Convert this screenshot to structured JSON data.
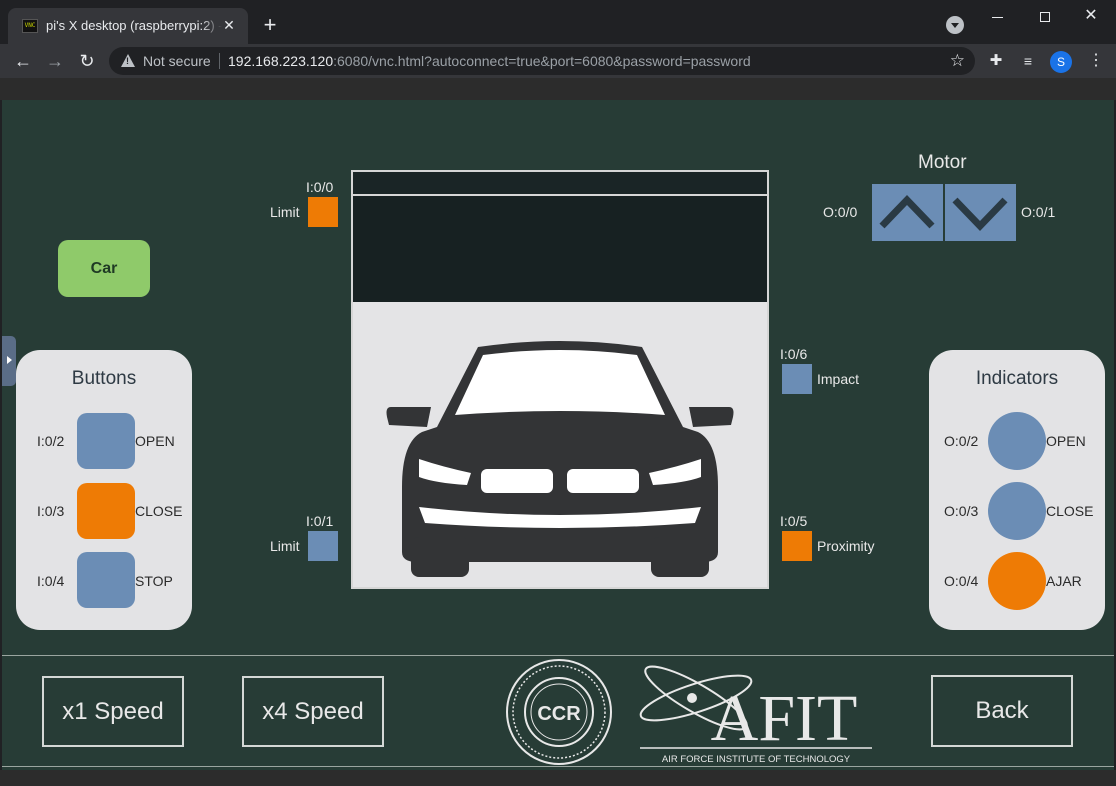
{
  "browser": {
    "tab_title": "pi's X desktop (raspberrypi:2) - noVNC",
    "favicon_text": "VNC",
    "tab_close": "✕",
    "new_tab": "+",
    "not_secure": "Not secure",
    "url_host": "192.168.223.120",
    "url_rest": ":6080/vnc.html?autoconnect=true&port=6080&password=password",
    "profile_initial": "S"
  },
  "hmi": {
    "car_button": "Car",
    "buttons_panel": {
      "title": "Buttons",
      "items": [
        {
          "address": "I:0/2",
          "label": "OPEN",
          "color": "#6b8db5"
        },
        {
          "address": "I:0/3",
          "label": "CLOSE",
          "color": "#ee7b05"
        },
        {
          "address": "I:0/4",
          "label": "STOP",
          "color": "#6b8db5"
        }
      ]
    },
    "indicators_panel": {
      "title": "Indicators",
      "items": [
        {
          "address": "O:0/2",
          "label": "OPEN",
          "color": "#6b8db5"
        },
        {
          "address": "O:0/3",
          "label": "CLOSE",
          "color": "#6b8db5"
        },
        {
          "address": "O:0/4",
          "label": "AJAR",
          "color": "#ee7b05"
        }
      ]
    },
    "sensors": {
      "limit_top": {
        "address": "I:0/0",
        "label": "Limit",
        "color": "#ee7b05"
      },
      "limit_bottom": {
        "address": "I:0/1",
        "label": "Limit",
        "color": "#6b8db5"
      },
      "impact": {
        "address": "I:0/6",
        "label": "Impact",
        "color": "#6b8db5"
      },
      "proximity": {
        "address": "I:0/5",
        "label": "Proximity",
        "color": "#ee7b05"
      }
    },
    "motor": {
      "title": "Motor",
      "up_address": "O:0/0",
      "down_address": "O:0/1"
    },
    "speed_x1": "x1 Speed",
    "speed_x4": "x4 Speed",
    "back": "Back",
    "ccr_text": "CCR",
    "afit_text": "AFIT",
    "afit_subtitle": "AIR FORCE INSTITUTE OF TECHNOLOGY"
  }
}
